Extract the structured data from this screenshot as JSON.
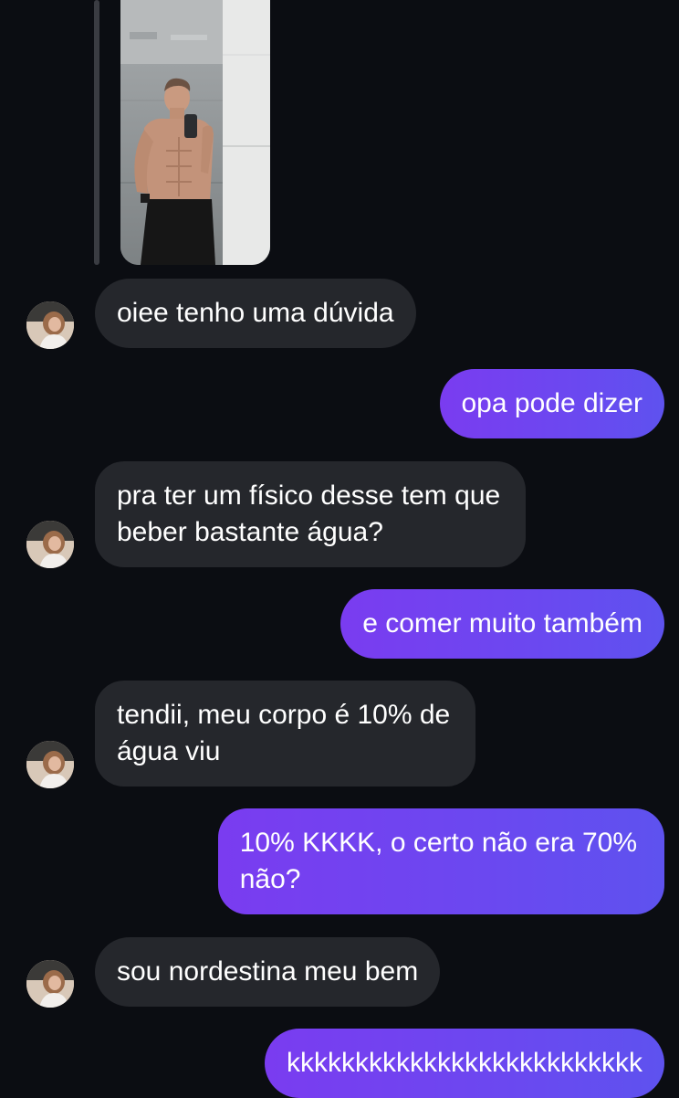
{
  "conversation": {
    "messages": [
      {
        "sender": "them",
        "text": "oiee tenho uma dúvida"
      },
      {
        "sender": "me",
        "text": "opa pode dizer"
      },
      {
        "sender": "them",
        "line1": "pra ter um físico desse tem que",
        "line2": "beber bastante água?"
      },
      {
        "sender": "me",
        "text": "e comer muito também"
      },
      {
        "sender": "them",
        "line1": "tendii, meu corpo é 10% de",
        "line2": "água viu"
      },
      {
        "sender": "me",
        "line1": "10% KKKK, o certo não era 70%",
        "line2": "não?"
      },
      {
        "sender": "them",
        "text": "sou nordestina meu bem"
      },
      {
        "sender": "me",
        "text": "kkkkkkkkkkkkkkkkkkkkkkkkkk"
      }
    ]
  },
  "colors": {
    "background": "#0b0d12",
    "incoming_bubble": "#25272c",
    "outgoing_bubble_start": "#7a3cf0",
    "outgoing_bubble_end": "#5e52ef",
    "text": "#ffffff"
  },
  "icons": {
    "avatar": "contact-avatar-photo",
    "shared_photo": "mirror-selfie-photo"
  }
}
